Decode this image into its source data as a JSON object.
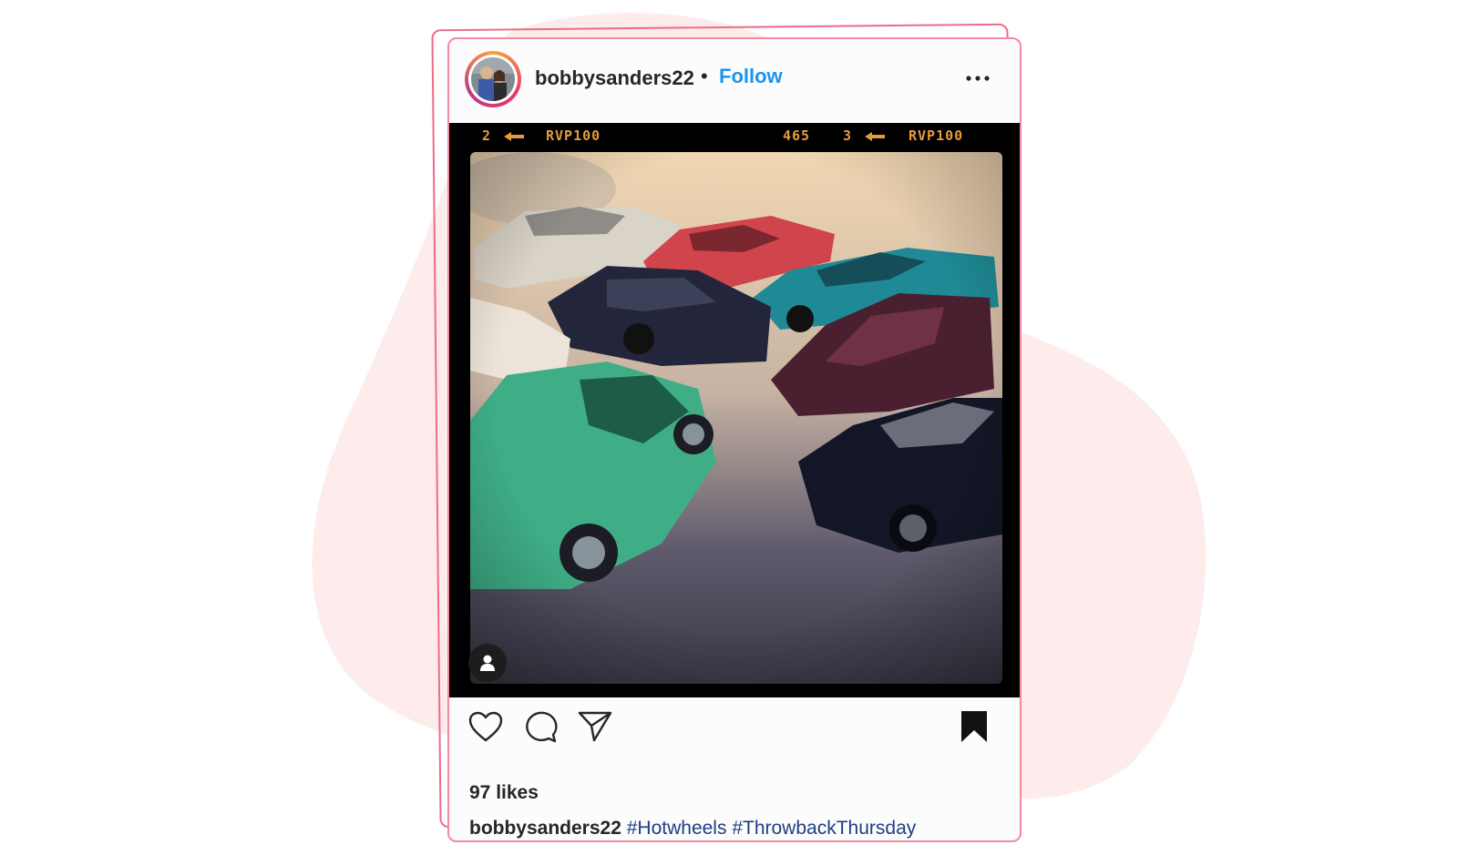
{
  "post": {
    "username": "bobbysanders22",
    "separator": "•",
    "follow_label": "Follow",
    "more_icon": "more-horizontal-icon",
    "film_labels": [
      "2",
      "RVP100",
      "465",
      "3",
      "RVP100"
    ],
    "likes": "97 likes",
    "caption": {
      "username": "bobbysanders22",
      "hashtags": [
        "#Hotwheels",
        "#ThrowbackThursday"
      ]
    },
    "actions": [
      "heart-icon",
      "comment-icon",
      "share-icon",
      "bookmark-icon"
    ]
  },
  "colors": {
    "accent_follow": "#1a95ef",
    "hashtag": "#1c3f82",
    "frame_border": "#f38aa0",
    "background_blob": "#fdeceb"
  }
}
